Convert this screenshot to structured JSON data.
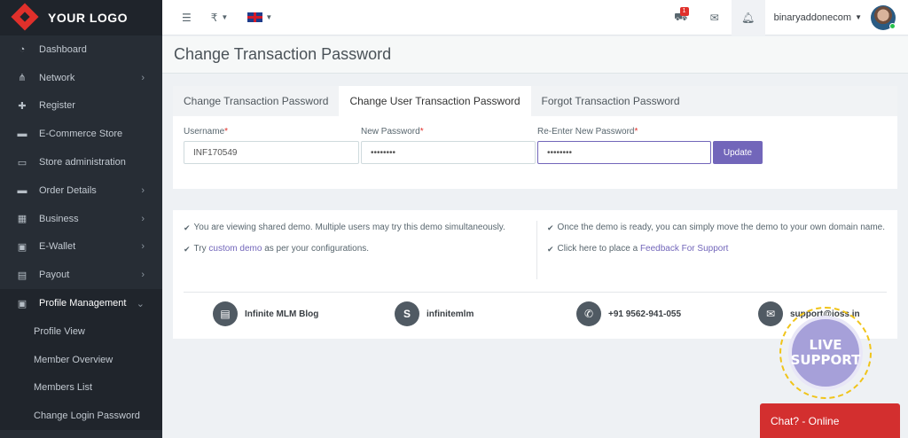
{
  "brand": {
    "logo_text": "YOUR LOGO"
  },
  "sidebar": {
    "items": [
      {
        "label": "Dashboard",
        "icon": "dashboard-icon",
        "has_children": false
      },
      {
        "label": "Network",
        "icon": "sitemap-icon",
        "has_children": true
      },
      {
        "label": "Register",
        "icon": "user-plus-icon",
        "has_children": false
      },
      {
        "label": "E-Commerce Store",
        "icon": "cart-icon",
        "has_children": false
      },
      {
        "label": "Store administration",
        "icon": "cart-outline-icon",
        "has_children": false
      },
      {
        "label": "Order Details",
        "icon": "cart-icon",
        "has_children": true
      },
      {
        "label": "Business",
        "icon": "calculator-icon",
        "has_children": true
      },
      {
        "label": "E-Wallet",
        "icon": "wallet-icon",
        "has_children": true
      },
      {
        "label": "Payout",
        "icon": "money-icon",
        "has_children": true
      },
      {
        "label": "Profile Management",
        "icon": "profile-icon",
        "has_children": true,
        "expanded": true
      }
    ],
    "submenu": [
      {
        "label": "Profile View"
      },
      {
        "label": "Member Overview"
      },
      {
        "label": "Members List"
      },
      {
        "label": "Change Login Password"
      }
    ]
  },
  "topbar": {
    "currency": "₹",
    "cart_count": "1",
    "username": "binaryaddonecom"
  },
  "page": {
    "title": "Change Transaction Password"
  },
  "tabs": [
    {
      "label": "Change Transaction Password",
      "active": false
    },
    {
      "label": "Change User Transaction Password",
      "active": true
    },
    {
      "label": "Forgot Transaction Password",
      "active": false
    }
  ],
  "form": {
    "username_label": "Username",
    "username_value": "INF170549",
    "new_password_label": "New Password",
    "new_password_value": "••••••••",
    "reenter_label": "Re-Enter New Password",
    "reenter_value": "••••••••",
    "required_mark": "*",
    "update_label": "Update"
  },
  "info": {
    "left_1": "You are viewing shared demo. Multiple users may try this demo simultaneously.",
    "left_2_pre": "Try ",
    "left_2_link": "custom demo",
    "left_2_post": " as per your configurations.",
    "right_1": "Once the demo is ready, you can simply move the demo to your own domain name.",
    "right_2_pre": "Click here to place a ",
    "right_2_link": "Feedback For Support"
  },
  "contacts": [
    {
      "label": "Infinite MLM Blog",
      "icon": "newspaper-icon"
    },
    {
      "label": "infinitemlm",
      "icon": "skype-icon"
    },
    {
      "label": "+91 9562-941-055",
      "icon": "whatsapp-icon"
    },
    {
      "label": "support@ioss.in",
      "icon": "envelope-icon"
    }
  ],
  "live_support": {
    "line1": "LIVE",
    "line2": "SUPPORT"
  },
  "chat": {
    "label": "Chat? - Online"
  },
  "colors": {
    "accent": "#7266ba",
    "sidebar": "#272d35",
    "danger": "#d32f2f"
  }
}
